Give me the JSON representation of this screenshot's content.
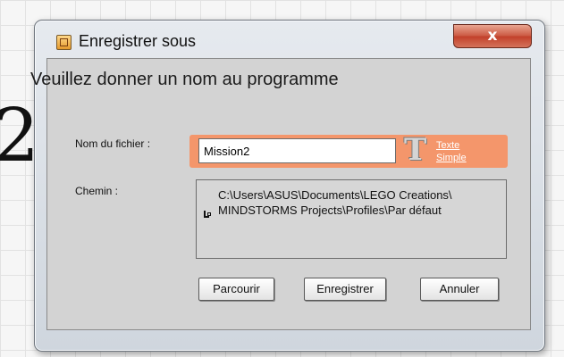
{
  "background": {
    "partial_glyph": "2"
  },
  "dialog": {
    "title": "Enregistrer sous",
    "close_symbol": "x",
    "heading": "Veuillez donner un nom au programme",
    "filename": {
      "label": "Nom du fichier :",
      "value": "Mission2"
    },
    "text_style": {
      "icon": "text-format-icon",
      "link_line1": "Texte",
      "link_line2": "Simple"
    },
    "path": {
      "label": "Chemin :",
      "value": "C:\\Users\\ASUS\\Documents\\LEGO Creations\\\nMINDSTORMS Projects\\Profiles\\Par défaut"
    },
    "buttons": {
      "browse": "Parcourir",
      "save": "Enregistrer",
      "cancel": "Annuler"
    }
  },
  "colors": {
    "accent_strip": "#f4966b",
    "close_button": "#c2402a"
  }
}
